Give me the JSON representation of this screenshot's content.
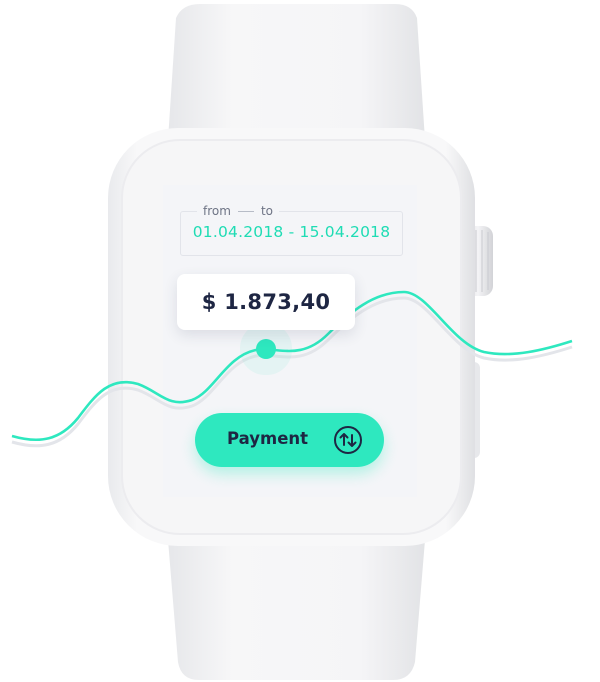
{
  "date_filter": {
    "from_label": "from",
    "to_label": "to",
    "range": "01.04.2018 - 15.04.2018"
  },
  "balance": {
    "amount": "$ 1.873,40"
  },
  "payment": {
    "label": "Payment",
    "icon": "swap-vertical-arrows-icon"
  },
  "colors": {
    "accent": "#2ee8bf",
    "text_dark": "#1e2643",
    "screen_bg": "#f4f5f8",
    "watch_body": "#f3f3f5"
  }
}
